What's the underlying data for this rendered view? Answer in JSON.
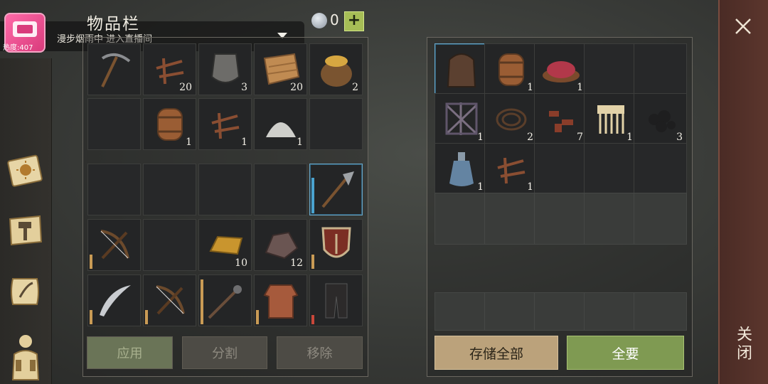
{
  "header": {
    "title": "物品栏",
    "gem_count": "0",
    "plus_label": "+"
  },
  "stream_banner": {
    "text": "漫步烟雨中 进入直播间",
    "heat": "热度:407"
  },
  "close": {
    "label": "关闭"
  },
  "buttons": {
    "apply": "应用",
    "split": "分割",
    "remove": "移除",
    "store_all": "存储全部",
    "take_all": "全要"
  },
  "inventory_top": [
    {
      "icon": "pickaxe-icon",
      "count": ""
    },
    {
      "icon": "nails-icon",
      "count": "20"
    },
    {
      "icon": "metal-plate-icon",
      "count": "3"
    },
    {
      "icon": "cloth-icon",
      "count": "20"
    },
    {
      "icon": "grain-sack-icon",
      "count": "2"
    },
    {
      "icon": "",
      "count": ""
    },
    {
      "icon": "barrel-icon",
      "count": "1"
    },
    {
      "icon": "nails-icon",
      "count": "1"
    },
    {
      "icon": "salt-pile-icon",
      "count": "1"
    },
    {
      "icon": "",
      "count": ""
    }
  ],
  "inventory_bottom": [
    {
      "icon": "",
      "count": ""
    },
    {
      "icon": "",
      "count": ""
    },
    {
      "icon": "",
      "count": ""
    },
    {
      "icon": "",
      "count": ""
    },
    {
      "icon": "halberd-icon",
      "count": "",
      "durability": 0.75,
      "selected": true
    },
    {
      "icon": "crossbow-icon",
      "count": "",
      "durability": 0.3
    },
    {
      "icon": "",
      "count": ""
    },
    {
      "icon": "gold-ingot-icon",
      "count": "10"
    },
    {
      "icon": "iron-ore-icon",
      "count": "12"
    },
    {
      "icon": "shield-icon",
      "count": "",
      "durability": 0.3
    },
    {
      "icon": "sabre-icon",
      "count": "",
      "durability": 0.3
    },
    {
      "icon": "crossbow-icon",
      "count": "",
      "durability": 0.3
    },
    {
      "icon": "mace-spear-icon",
      "count": "",
      "durability": 0.95
    },
    {
      "icon": "chainmail-icon",
      "count": "",
      "durability": 0.3
    },
    {
      "icon": "leather-pants-icon",
      "count": "",
      "durability": 0.2
    }
  ],
  "storage": [
    {
      "icon": "backpack-icon",
      "count": "",
      "selected": true
    },
    {
      "icon": "barrel-icon",
      "count": "1"
    },
    {
      "icon": "raw-meat-bowl-icon",
      "count": "1"
    },
    {
      "icon": "",
      "count": ""
    },
    {
      "icon": "",
      "count": ""
    },
    {
      "icon": "iron-grate-icon",
      "count": "1"
    },
    {
      "icon": "rope-icon",
      "count": "2"
    },
    {
      "icon": "bone-fragments-icon",
      "count": "7"
    },
    {
      "icon": "comb-icon",
      "count": "1"
    },
    {
      "icon": "coal-icon",
      "count": "3"
    },
    {
      "icon": "potion-flask-icon",
      "count": "1"
    },
    {
      "icon": "nails-icon",
      "count": "1"
    },
    {
      "icon": "",
      "count": ""
    },
    {
      "icon": "",
      "count": ""
    },
    {
      "icon": "",
      "count": ""
    },
    {
      "icon": "",
      "count": ""
    },
    {
      "icon": "",
      "count": ""
    },
    {
      "icon": "",
      "count": ""
    },
    {
      "icon": "",
      "count": ""
    },
    {
      "icon": "",
      "count": ""
    }
  ],
  "rail": [
    "sun-book-icon",
    "crafting-hammer-icon",
    "quest-scroll-icon",
    "character-icon"
  ],
  "colors": {
    "accent_green": "#7f9a52",
    "accent_tan": "#bba27b",
    "close_panel": "#5c362d"
  }
}
